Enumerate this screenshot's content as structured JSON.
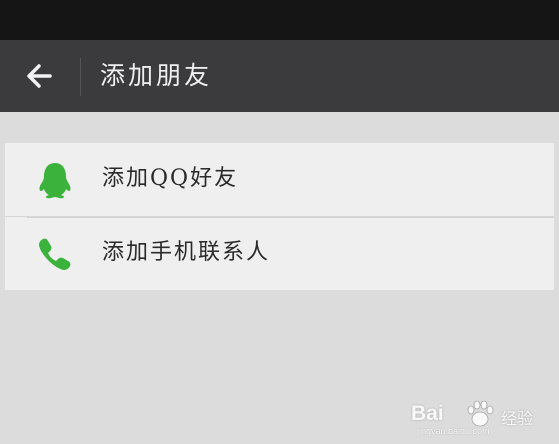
{
  "header": {
    "back_icon": "arrow-left-icon",
    "title": "添加朋友"
  },
  "menu": {
    "items": [
      {
        "label": "添加QQ好友",
        "icon": "qq-penguin-icon",
        "icon_color": "#3bb23b"
      },
      {
        "label": "添加手机联系人",
        "icon": "phone-icon",
        "icon_color": "#3bb23b"
      }
    ]
  },
  "watermark": {
    "brand": "Bai",
    "brand_suffix": "经验",
    "url": "jingyan.baidu.com"
  },
  "colors": {
    "status_bar": "#151515",
    "top_bar": "#3b3b3d",
    "background": "#dcdcdc",
    "list_bg": "#efefef",
    "accent_green": "#3bb23b"
  }
}
